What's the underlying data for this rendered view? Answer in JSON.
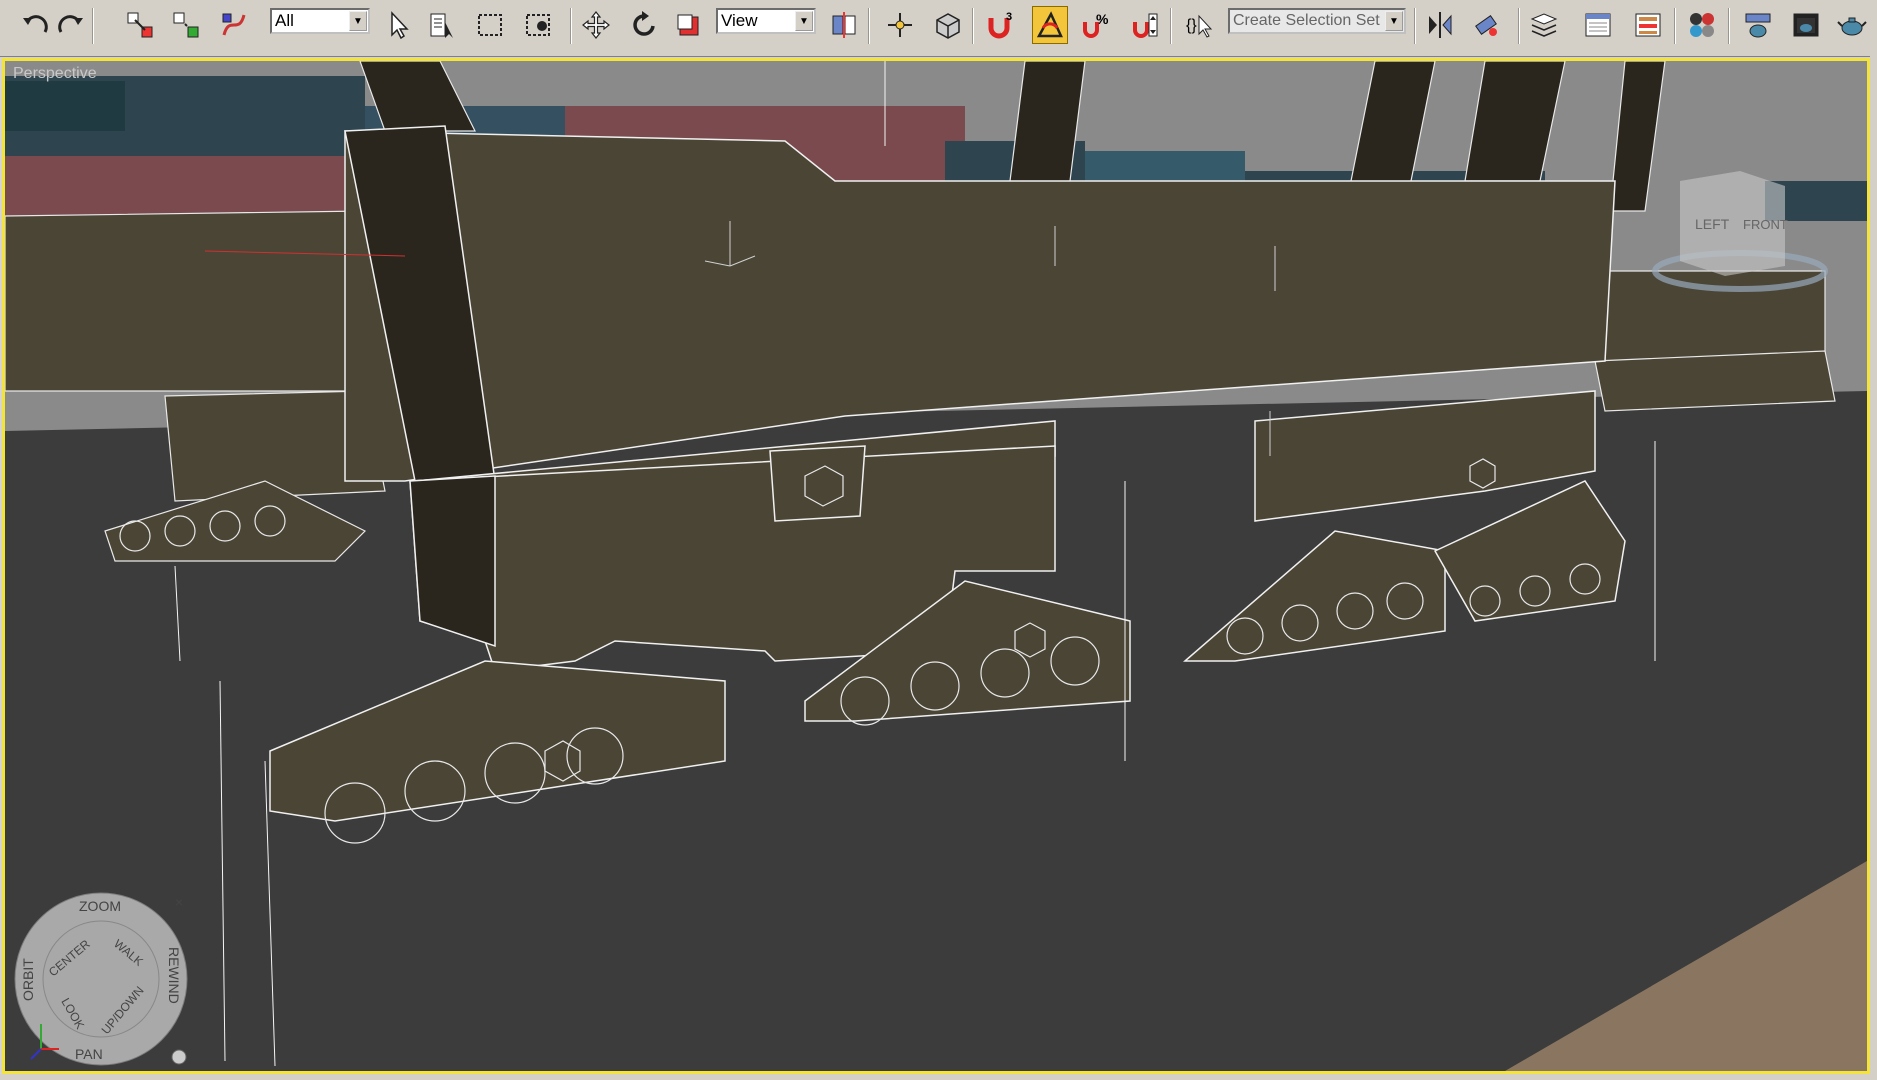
{
  "toolbar": {
    "filter_value": "All",
    "refcoord_value": "View",
    "snap_value": "3",
    "selection_set_placeholder": "Create Selection Set",
    "buttons": [
      {
        "name": "undo-button",
        "icon": "undo-icon"
      },
      {
        "name": "redo-button",
        "icon": "redo-icon"
      },
      {
        "name": "select-and-link-button",
        "icon": "link-icon"
      },
      {
        "name": "unlink-selection-button",
        "icon": "unlink-icon"
      },
      {
        "name": "bind-to-space-warp-button",
        "icon": "spacewarp-icon"
      },
      {
        "name": "select-object-button",
        "icon": "cursor-arrow-icon"
      },
      {
        "name": "select-by-name-button",
        "icon": "select-by-name-icon"
      },
      {
        "name": "rectangular-selection-button",
        "icon": "rect-selection-icon"
      },
      {
        "name": "window-crossing-button",
        "icon": "window-crossing-icon"
      },
      {
        "name": "select-and-move-button",
        "icon": "move-icon"
      },
      {
        "name": "select-and-rotate-button",
        "icon": "rotate-icon"
      },
      {
        "name": "select-and-scale-button",
        "icon": "scale-icon"
      },
      {
        "name": "use-pivot-center-button",
        "icon": "pivot-icon"
      },
      {
        "name": "select-and-manipulate-button",
        "icon": "manipulate-icon"
      },
      {
        "name": "keyboard-shortcut-override-button",
        "icon": "keyboard-icon"
      },
      {
        "name": "snaps-toggle-button",
        "icon": "magnet-snap-icon"
      },
      {
        "name": "angle-snap-toggle-button",
        "icon": "angle-snap-icon"
      },
      {
        "name": "percent-snap-toggle-button",
        "icon": "percent-snap-icon"
      },
      {
        "name": "spinner-snap-toggle-button",
        "icon": "spinner-snap-icon"
      },
      {
        "name": "edit-named-selection-button",
        "icon": "named-selection-icon"
      },
      {
        "name": "mirror-button",
        "icon": "mirror-icon"
      },
      {
        "name": "align-button",
        "icon": "align-icon"
      },
      {
        "name": "layer-manager-button",
        "icon": "layers-icon"
      },
      {
        "name": "curve-editor-button",
        "icon": "curve-editor-icon"
      },
      {
        "name": "schematic-view-button",
        "icon": "schematic-icon"
      },
      {
        "name": "material-editor-button",
        "icon": "material-spheres-icon"
      },
      {
        "name": "render-setup-button",
        "icon": "teapot-setup-icon"
      },
      {
        "name": "rendered-frame-window-button",
        "icon": "frame-window-icon"
      },
      {
        "name": "render-production-button",
        "icon": "teapot-render-icon"
      }
    ]
  },
  "viewport": {
    "label": "Perspective",
    "viewcube": {
      "left_face": "LEFT",
      "front_face": "FRONT"
    },
    "steering_wheel": {
      "zoom": "ZOOM",
      "center": "CENTER",
      "walk": "WALK",
      "orbit": "ORBIT",
      "rewind": "REWIND",
      "look": "LOOK",
      "updown": "UP/DOWN",
      "pan": "PAN"
    }
  },
  "colors": {
    "active_viewport_border": "#f2e43c",
    "active_button": "#f3c53b",
    "ui_gray": "#d4d0c8",
    "model_fill": "#4b4536",
    "ground": "#3a3a3a",
    "sky": "#8a8a8a"
  }
}
